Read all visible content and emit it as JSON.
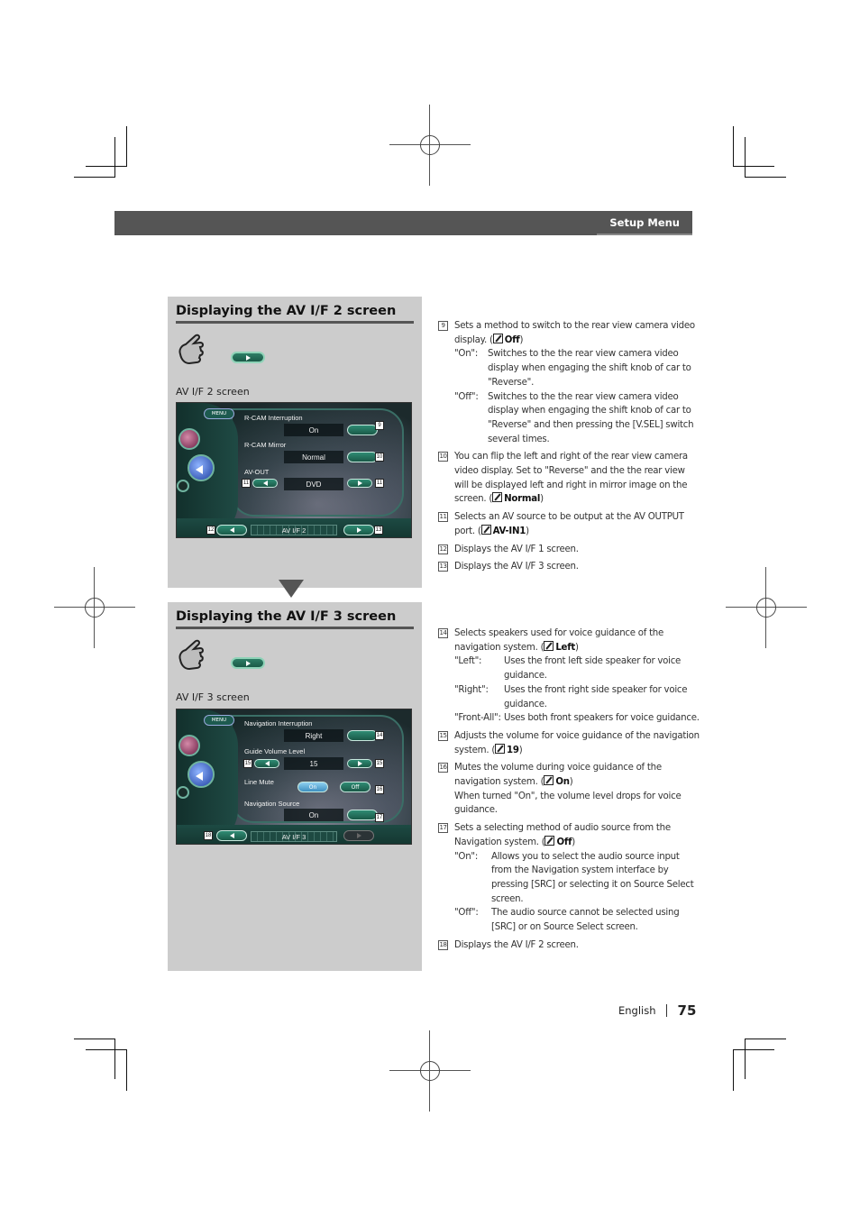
{
  "header": {
    "section": "Setup Menu"
  },
  "panels": [
    {
      "title": "Displaying the AV I/F 2 screen",
      "caption": "AV I/F 2 screen",
      "screen": {
        "menu_label": "MENU",
        "rows": [
          {
            "label": "R-CAM Interruption",
            "value": "On",
            "callout": "9"
          },
          {
            "label": "R-CAM Mirror",
            "value": "Normal",
            "callout": "10"
          },
          {
            "label": "AV-OUT",
            "value": "DVD",
            "callout": "11"
          }
        ],
        "nav_title": "AV I/F  2",
        "prev_callout": "12",
        "next_callout": "13"
      }
    },
    {
      "title": "Displaying the AV I/F 3 screen",
      "caption": "AV I/F 3 screen",
      "screen": {
        "menu_label": "MENU",
        "rows": [
          {
            "label": "Navigation Interruption",
            "value": "Right",
            "callout": "14"
          },
          {
            "label": "Guide Volume Level",
            "value": "15",
            "callout": "15"
          },
          {
            "label": "Line Mute",
            "on_label": "On",
            "off_label": "Off",
            "callout": "16"
          },
          {
            "label": "Navigation Source",
            "value": "On",
            "callout": "17"
          }
        ],
        "nav_title": "AV I/F  3",
        "prev_callout": "18"
      }
    }
  ],
  "descriptions_1": [
    {
      "num": "9",
      "text": "Sets a method to switch to the rear view camera video display.",
      "default": "Off",
      "options": [
        {
          "key": "\"On\":",
          "text": "Switches to the the rear view camera video display when engaging  the shift knob of car to \"Reverse\"."
        },
        {
          "key": "\"Off\":",
          "text": "Switches to the the rear view camera video display when engaging  the shift knob of car to \"Reverse\" and then pressing the [V.SEL] switch several times."
        }
      ]
    },
    {
      "num": "10",
      "text": "You can flip the left and right of the rear view camera video display. Set to  \"Reverse\" and the the rear view will be displayed left and right in mirror image on the screen.",
      "default": "Normal"
    },
    {
      "num": "11",
      "text": "Selects an AV source to be output at the AV OUTPUT port.",
      "default": "AV-IN1"
    },
    {
      "num": "12",
      "text": "Displays the AV I/F 1 screen."
    },
    {
      "num": "13",
      "text": "Displays the AV I/F 3 screen."
    }
  ],
  "descriptions_2": [
    {
      "num": "14",
      "text": "Selects speakers used for voice guidance of the navigation system.",
      "default": "Left",
      "options": [
        {
          "key": "\"Left\":",
          "text": "Uses the front left side speaker for voice guidance."
        },
        {
          "key": "\"Right\":",
          "text": "Uses the front right side speaker for voice guidance."
        },
        {
          "key": "\"Front-All\":",
          "text": "Uses both front speakers for voice guidance."
        }
      ]
    },
    {
      "num": "15",
      "text": "Adjusts the volume for voice guidance of the navigation system.",
      "default": "19"
    },
    {
      "num": "16",
      "text": "Mutes the volume during voice guidance of the navigation system.",
      "default": "On",
      "note": "When turned \"On\", the volume level drops for voice guidance."
    },
    {
      "num": "17",
      "text": "Sets a selecting method of audio source from the Navigation system.",
      "default": "Off",
      "options": [
        {
          "key": "\"On\":",
          "text": "Allows you to select the audio source input from the Navigation system interface by pressing [SRC] or selecting it on Source Select screen."
        },
        {
          "key": "\"Off\":",
          "text": "The audio source cannot be selected using [SRC] or on Source Select screen."
        }
      ]
    },
    {
      "num": "18",
      "text": "Displays the AV I/F 2 screen."
    }
  ],
  "footer": {
    "language": "English",
    "page": "75"
  }
}
